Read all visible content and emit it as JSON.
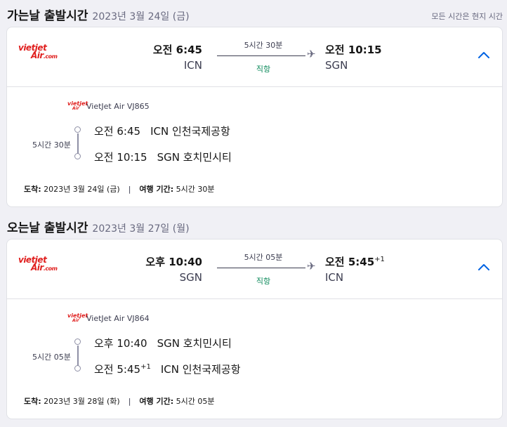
{
  "outbound": {
    "title": "가는날 출발시간",
    "date": "2023년 3월 24일 (금)",
    "local_note": "모든 시간은 현지 시간",
    "logo": {
      "line1": "vietjet",
      "line2": "Air",
      "line2_suffix": ".com"
    },
    "dep_time": "오전 6:45",
    "dep_code": "ICN",
    "duration": "5시간 30분",
    "stops": "직항",
    "arr_time": "오전 10:15",
    "arr_offset": "",
    "arr_code": "SGN",
    "toggle_icon": "chevron-up",
    "detail": {
      "carrier": "VietJet Air VJ865",
      "duration": "5시간 30분",
      "dep": {
        "time": "오전 6:45",
        "offset": "",
        "airport": "ICN 인천국제공항"
      },
      "arr": {
        "time": "오전 10:15",
        "offset": "",
        "airport": "SGN 호치민시티"
      },
      "arrive_label": "도착:",
      "arrive_date": "2023년 3월 24일 (금)",
      "travel_label": "여행 기간:",
      "travel_time": "5시간 30분"
    }
  },
  "return": {
    "title": "오는날 출발시간",
    "date": "2023년 3월 27일 (월)",
    "logo": {
      "line1": "vietjet",
      "line2": "Air",
      "line2_suffix": ".com"
    },
    "dep_time": "오후 10:40",
    "dep_code": "SGN",
    "duration": "5시간 05분",
    "stops": "직항",
    "arr_time": "오전 5:45",
    "arr_offset": "+1",
    "arr_code": "ICN",
    "toggle_icon": "chevron-up",
    "detail": {
      "carrier": "VietJet Air VJ864",
      "duration": "5시간 05분",
      "dep": {
        "time": "오후 10:40",
        "offset": "",
        "airport": "SGN 호치민시티"
      },
      "arr": {
        "time": "오전 5:45",
        "offset": "+1",
        "airport": "ICN 인천국제공항"
      },
      "arrive_label": "도착:",
      "arrive_date": "2023년 3월 28일 (화)",
      "travel_label": "여행 기간:",
      "travel_time": "5시간 05분"
    }
  },
  "colors": {
    "brand": "#e0201f",
    "accent": "#0062e3",
    "direct": "#0c8a5b"
  }
}
